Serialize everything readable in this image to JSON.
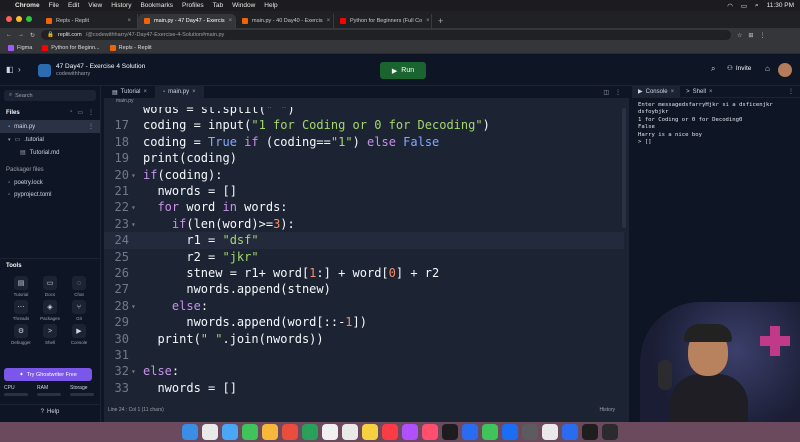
{
  "menubar": {
    "app": "Chrome",
    "items": [
      "File",
      "Edit",
      "View",
      "History",
      "Bookmarks",
      "Profiles",
      "Tab",
      "Window",
      "Help"
    ],
    "clock": "11:30 PM"
  },
  "browser": {
    "tabs": [
      {
        "label": "Repls - Replit",
        "color": "#f26207",
        "active": false
      },
      {
        "label": "main.py - 47 Day47 - Exercis",
        "color": "#f26207",
        "active": true
      },
      {
        "label": "main.py - 40 Day40 - Exercis",
        "color": "#f26207",
        "active": false
      },
      {
        "label": "Python for Beginners (Full Co",
        "color": "#ff0000",
        "active": false
      }
    ],
    "url_host": "replit.com",
    "url_path": "/@codewithharry/47-Day47-Exercise-4-Solution#main.py",
    "bookmarks": [
      "Figma",
      "Python for Beginn...",
      "Repls - Replit"
    ]
  },
  "replit": {
    "project_title": "47 Day47 - Exercise 4 Solution",
    "owner": "codewithharry",
    "run_label": "Run",
    "invite_label": "Invite"
  },
  "sidebar": {
    "search_placeholder": "Search",
    "files_heading": "Files",
    "files": [
      {
        "name": "main.py",
        "selected": true,
        "child": false
      },
      {
        "name": ".tutorial",
        "selected": false,
        "child": false
      },
      {
        "name": "Tutorial.md",
        "selected": false,
        "child": true
      }
    ],
    "packager_heading": "Packager files",
    "packager_files": [
      "poetry.lock",
      "pyproject.toml"
    ],
    "tools_heading": "Tools",
    "tools": [
      {
        "label": "Tutorial",
        "glyph": "▤"
      },
      {
        "label": "Docs",
        "glyph": "▭"
      },
      {
        "label": "Chat",
        "glyph": "◌"
      },
      {
        "label": "Threads",
        "glyph": "⋯"
      },
      {
        "label": "Packages",
        "glyph": "◈"
      },
      {
        "label": "Git",
        "glyph": "⑂"
      },
      {
        "label": "Debugger",
        "glyph": "⚙"
      },
      {
        "label": "Shell",
        "glyph": ">"
      },
      {
        "label": "Console",
        "glyph": "▶"
      }
    ],
    "ghostwriter_label": "Try Ghostwriter Free",
    "stats": [
      "CPU",
      "RAM",
      "Storage"
    ],
    "help_label": "Help"
  },
  "editor": {
    "tabs": [
      "Tutorial",
      "main.py"
    ],
    "breadcrumb": "main.py",
    "status": "Line 24 : Col 1 (11 chars)",
    "history_label": "History",
    "current_line": 24,
    "lines": [
      {
        "n": "",
        "fold": false,
        "code": "words = st.split(\" \")"
      },
      {
        "n": "17",
        "fold": false,
        "code": "coding = input(\"1 for Coding or 0 for Decoding\")"
      },
      {
        "n": "18",
        "fold": false,
        "code": "coding = True if (coding==\"1\") else False"
      },
      {
        "n": "19",
        "fold": false,
        "code": "print(coding)"
      },
      {
        "n": "20",
        "fold": true,
        "code": "if(coding):"
      },
      {
        "n": "21",
        "fold": false,
        "code": "  nwords = []"
      },
      {
        "n": "22",
        "fold": true,
        "code": "  for word in words:"
      },
      {
        "n": "23",
        "fold": true,
        "code": "    if(len(word)>=3):"
      },
      {
        "n": "24",
        "fold": false,
        "code": "      r1 = \"dsf\""
      },
      {
        "n": "25",
        "fold": false,
        "code": "      r2 = \"jkr\""
      },
      {
        "n": "26",
        "fold": false,
        "code": "      stnew = r1+ word[1:] + word[0] + r2"
      },
      {
        "n": "27",
        "fold": false,
        "code": "      nwords.append(stnew)"
      },
      {
        "n": "28",
        "fold": true,
        "code": "    else:"
      },
      {
        "n": "29",
        "fold": false,
        "code": "      nwords.append(word[::-1])"
      },
      {
        "n": "30",
        "fold": false,
        "code": "  print(\" \".join(nwords))"
      },
      {
        "n": "31",
        "fold": false,
        "code": ""
      },
      {
        "n": "32",
        "fold": true,
        "code": "else:"
      },
      {
        "n": "33",
        "fold": false,
        "code": "  nwords = []"
      }
    ]
  },
  "console": {
    "tabs": [
      "Console",
      "Shell"
    ],
    "output": [
      "Enter messagedsfarryHjkr si a dsficenjkr",
      "dsfoybjkr",
      "1 for Coding or 0 for Decoding0",
      "False",
      "Harry is a nice boy",
      "> []"
    ]
  },
  "dock": {
    "colors": [
      "#3a8ee6",
      "#e9e9ea",
      "#4aa7f5",
      "#3fc35a",
      "#f6b73c",
      "#e84d3d",
      "#2aa15a",
      "#f0f0f0",
      "#e9e9ea",
      "#f5d142",
      "#fc3c44",
      "#b050ff",
      "#ff4e6e",
      "#1c1c1e",
      "#2a6cf0",
      "#3fc35a",
      "#1b6ef3",
      "#5b5b60",
      "#e9e9ea",
      "#2a6cf0",
      "#1e1e1e",
      "#2b2b2f"
    ]
  }
}
